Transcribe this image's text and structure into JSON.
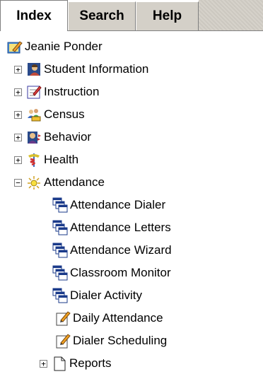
{
  "tabs": [
    {
      "label": "Index",
      "active": true
    },
    {
      "label": "Search",
      "active": false
    },
    {
      "label": "Help",
      "active": false
    }
  ],
  "tree": {
    "root": {
      "label": "Jeanie Ponder",
      "icon": "user-folder-icon"
    },
    "items": [
      {
        "label": "Student Information",
        "icon": "student-icon",
        "expander": "+"
      },
      {
        "label": "Instruction",
        "icon": "instruction-icon",
        "expander": "+"
      },
      {
        "label": "Census",
        "icon": "census-icon",
        "expander": "+"
      },
      {
        "label": "Behavior",
        "icon": "behavior-icon",
        "expander": "+"
      },
      {
        "label": "Health",
        "icon": "health-icon",
        "expander": "+"
      },
      {
        "label": "Attendance",
        "icon": "attendance-icon",
        "expander": "−"
      }
    ],
    "attendance_children": [
      {
        "label": "Attendance Dialer",
        "icon": "windows-icon"
      },
      {
        "label": "Attendance Letters",
        "icon": "windows-icon"
      },
      {
        "label": "Attendance Wizard",
        "icon": "windows-icon"
      },
      {
        "label": "Classroom Monitor",
        "icon": "windows-icon"
      },
      {
        "label": "Dialer Activity",
        "icon": "windows-icon"
      },
      {
        "label": "Daily Attendance",
        "icon": "note-pencil-icon"
      },
      {
        "label": "Dialer Scheduling",
        "icon": "note-pencil-icon"
      }
    ],
    "reports": {
      "label": "Reports",
      "icon": "document-icon",
      "expander": "+"
    }
  }
}
